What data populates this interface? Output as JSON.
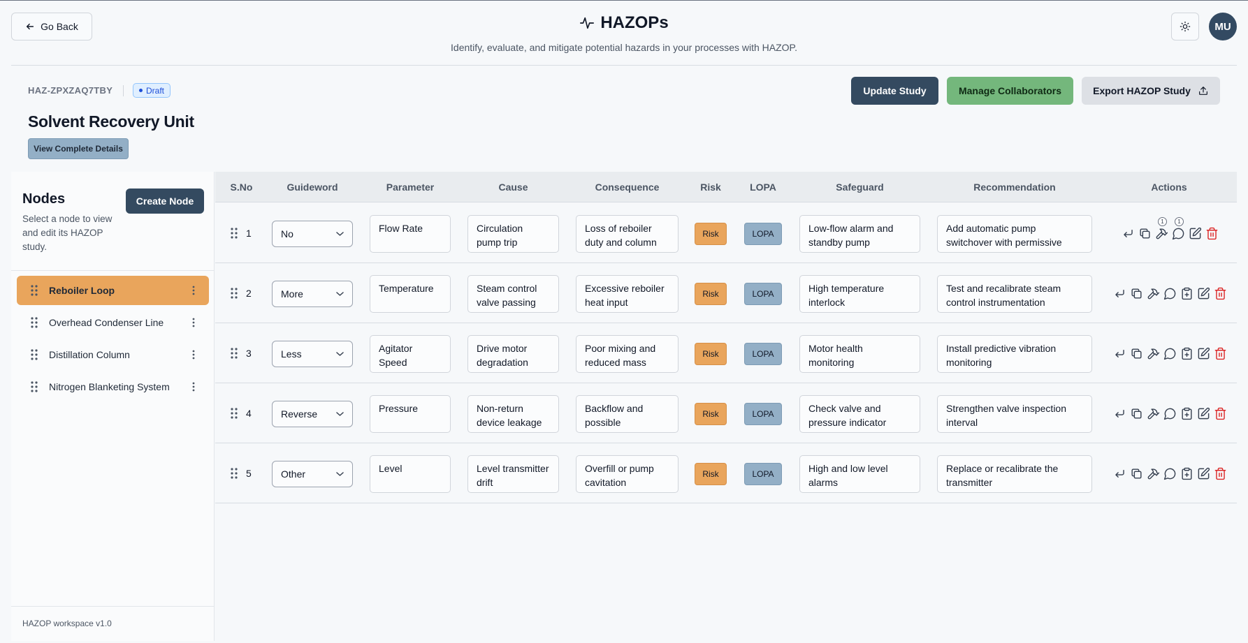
{
  "header": {
    "go_back": "Go Back",
    "title": "HAZOPs",
    "subtitle": "Identify, evaluate, and mitigate potential hazards in your processes with HAZOP.",
    "avatar": "MU",
    "theme_icon": "sun-icon",
    "title_icon": "activity-icon"
  },
  "study": {
    "id": "HAZ-ZPXZAQ7TBY",
    "status": "Draft",
    "title": "Solvent Recovery Unit",
    "details_button": "View Complete Details",
    "update_button": "Update Study",
    "collaborators_button": "Manage Collaborators",
    "export_button": "Export HAZOP Study"
  },
  "sidebar": {
    "title": "Nodes",
    "description": "Select a node to view and edit its HAZOP study.",
    "create_button": "Create Node",
    "items": [
      {
        "label": "Reboiler Loop",
        "active": true
      },
      {
        "label": "Overhead Condenser Line",
        "active": false
      },
      {
        "label": "Distillation Column",
        "active": false
      },
      {
        "label": "Nitrogen Blanketing System",
        "active": false
      }
    ],
    "footer": "HAZOP workspace v1.0"
  },
  "table": {
    "columns": [
      "S.No",
      "Guideword",
      "Parameter",
      "Cause",
      "Consequence",
      "Risk",
      "LOPA",
      "Safeguard",
      "Recommendation",
      "Actions"
    ],
    "risk_label": "Risk",
    "lopa_label": "LOPA",
    "rows": [
      {
        "sno": "1",
        "guideword": "No",
        "parameter": "Flow Rate",
        "cause": "Circulation pump trip",
        "consequence": "Loss of reboiler duty and column",
        "safeguard": "Low-flow alarm and standby pump",
        "recommendation": "Add automatic pump switchover with permissive",
        "badges": [
          "1",
          "1"
        ]
      },
      {
        "sno": "2",
        "guideword": "More",
        "parameter": "Temperature",
        "cause": "Steam control valve passing",
        "consequence": "Excessive reboiler heat input",
        "safeguard": "High temperature interlock",
        "recommendation": "Test and recalibrate steam control instrumentation"
      },
      {
        "sno": "3",
        "guideword": "Less",
        "parameter": "Agitator Speed",
        "cause": "Drive motor degradation",
        "consequence": "Poor mixing and reduced mass",
        "safeguard": "Motor health monitoring",
        "recommendation": "Install predictive vibration monitoring"
      },
      {
        "sno": "4",
        "guideword": "Reverse",
        "parameter": "Pressure",
        "cause": "Non-return device leakage",
        "consequence": "Backflow and possible",
        "safeguard": "Check valve and pressure indicator",
        "recommendation": "Strengthen valve inspection interval"
      },
      {
        "sno": "5",
        "guideword": "Other",
        "parameter": "Level",
        "cause": "Level transmitter drift",
        "consequence": "Overfill or pump cavitation",
        "safeguard": "High and low level alarms",
        "recommendation": "Replace or recalibrate the transmitter"
      }
    ]
  },
  "colors": {
    "primary": "#344a60",
    "success": "#74b77c",
    "risk": "#e9a55c",
    "lopa": "#93afc6",
    "danger": "#dc2626"
  }
}
